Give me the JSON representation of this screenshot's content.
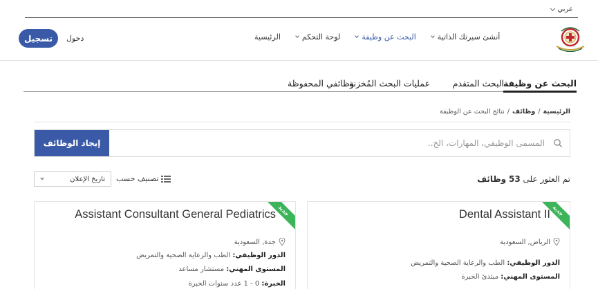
{
  "language": {
    "label": "عربي"
  },
  "header": {
    "register_label": "تسجيل",
    "login_label": "دخول",
    "nav": [
      {
        "label": "الرئيسية",
        "has_dropdown": false,
        "active": false
      },
      {
        "label": "لوحة التحكم",
        "has_dropdown": true,
        "active": false
      },
      {
        "label": "البحث عن وظيفة",
        "has_dropdown": true,
        "active": true
      },
      {
        "label": "أنشئ سيرتك الذاتية",
        "has_dropdown": true,
        "active": false
      }
    ],
    "accent_color": "#3a5aa8"
  },
  "tabs": [
    {
      "label": "البحث عن وظيفة",
      "active": true
    },
    {
      "label": "البحث المتقدم",
      "active": false
    },
    {
      "label": "عمليات البحث المُخزنة",
      "active": false
    },
    {
      "label": "وظائفي المحفوظة",
      "active": false
    }
  ],
  "breadcrumb": {
    "home": "الرئيسية",
    "sep": "/",
    "jobs": "وظائف",
    "current": "نتائج البحث عن الوظيفة"
  },
  "search": {
    "placeholder": "المسمى الوظيفي، المهارات، الخ..",
    "value": "",
    "button_label": "إيجاد الوظائف"
  },
  "results": {
    "prefix": "تم العثور على",
    "count": "53",
    "suffix": "وظائف"
  },
  "sort": {
    "label": "تصنيف حسب",
    "selected": "تاريخ الإعلان"
  },
  "jobs": [
    {
      "badge": "جديد",
      "title": "Dental Assistant II",
      "location": "الرياض, السعودية",
      "role_label": "الدور الوظيفي:",
      "role_value": "الطب والرعاية الصحية والتمريض",
      "level_label": "المستوى المهني:",
      "level_value": "مبتدئ الخبرة"
    },
    {
      "badge": "جديد",
      "title": "Assistant Consultant General Pediatrics",
      "location": "جدة, السعودية",
      "role_label": "الدور الوظيفي:",
      "role_value": "الطب والرعاية الصحية والتمريض",
      "level_label": "المستوى المهني:",
      "level_value": "مستشار مساعد",
      "exp_label": "الخبرة:",
      "exp_value": "0 - 1 عدد سنوات الخبرة"
    }
  ],
  "colors": {
    "badge_green": "#3cb45a",
    "logo_red": "#c0282d",
    "logo_gold": "#c9a23a"
  }
}
